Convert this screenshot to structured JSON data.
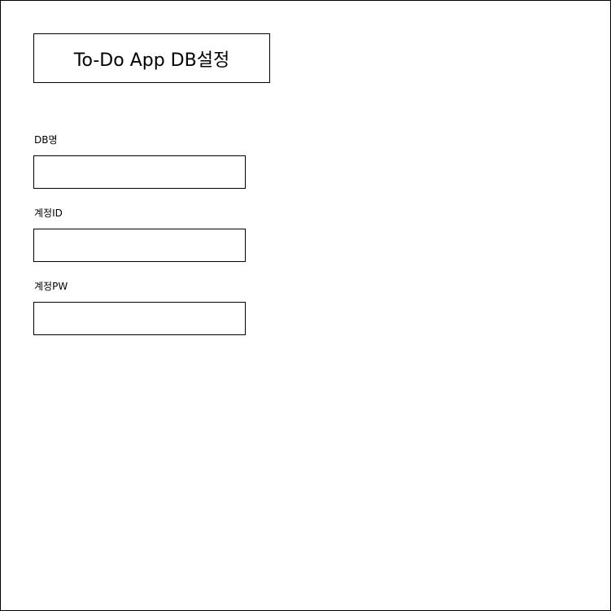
{
  "page": {
    "title": "To-Do App DB설정"
  },
  "form": {
    "db_name": {
      "label": "DB명",
      "value": "",
      "placeholder": ""
    },
    "account_id": {
      "label": "계정ID",
      "value": "",
      "placeholder": ""
    },
    "account_pw": {
      "label": "계정PW",
      "value": "",
      "placeholder": ""
    }
  }
}
